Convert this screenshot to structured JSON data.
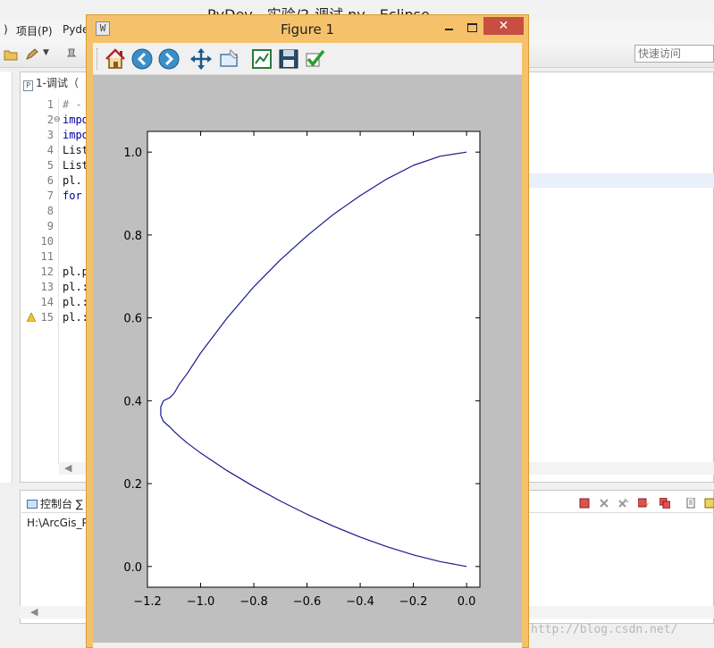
{
  "eclipse": {
    "title": "PyDev - 实验/2-调试.py - Eclipse",
    "menu": {
      "project": "项目(P)",
      "pydev": "Pyde"
    },
    "quick_access_placeholder": "快速访问",
    "editor_tab": "1-调试（",
    "line_numbers": [
      "1",
      "2",
      "3",
      "4",
      "5",
      "6",
      "7",
      "8",
      "9",
      "10",
      "11",
      "12",
      "13",
      "14",
      "15"
    ],
    "code_lines": [
      "# -",
      "impo",
      "impo",
      "List",
      "List",
      "pl.",
      "for",
      "",
      "",
      "",
      "",
      "pl.p",
      "pl.:",
      "pl.:",
      "pl.:"
    ],
    "console_tab": "控制台 ∑",
    "console_path": "H:\\ArcGis_P",
    "watermark": "http://blog.csdn.net/"
  },
  "figure": {
    "title": "Figure 1",
    "close_glyph": "✕",
    "app_icon_glyph": "W",
    "toolbar": [
      "home-icon",
      "back-arrow-icon",
      "forward-arrow-icon",
      "pan-move-icon",
      "zoom-rect-icon",
      "subplots-config-icon",
      "save-floppy-icon",
      "check-icon"
    ]
  },
  "chart_data": {
    "type": "line",
    "title": "",
    "xlabel": "",
    "ylabel": "",
    "xlim": [
      -1.2,
      0.05
    ],
    "ylim": [
      -0.05,
      1.05
    ],
    "xticks": [
      -1.2,
      -1.0,
      -0.8,
      -0.6,
      -0.4,
      -0.2,
      0.0
    ],
    "xtick_labels": [
      "−1.2",
      "−1.0",
      "−0.8",
      "−0.6",
      "−0.4",
      "−0.2",
      "0.0"
    ],
    "yticks": [
      0.0,
      0.2,
      0.4,
      0.6,
      0.8,
      1.0
    ],
    "ytick_labels": [
      "0.0",
      "0.2",
      "0.4",
      "0.6",
      "0.8",
      "1.0"
    ],
    "grid": false,
    "line_color": "#1a1a8c",
    "series": [
      {
        "x": [
          0.0,
          -0.1,
          -0.2,
          -0.3,
          -0.4,
          -0.5,
          -0.6,
          -0.7,
          -0.8,
          -0.9,
          -1.0,
          -1.05,
          -1.08,
          -1.1,
          -1.115,
          -1.14,
          -1.15,
          -1.15,
          -1.14,
          -1.115,
          -1.1,
          -1.08,
          -1.05,
          -1.0,
          -0.9,
          -0.8,
          -0.7,
          -0.6,
          -0.5,
          -0.4,
          -0.3,
          -0.2,
          -0.1,
          0.0
        ],
        "y": [
          0.0,
          0.012,
          0.028,
          0.048,
          0.071,
          0.097,
          0.126,
          0.158,
          0.193,
          0.231,
          0.274,
          0.298,
          0.314,
          0.326,
          0.336,
          0.35,
          0.365,
          0.385,
          0.4,
          0.408,
          0.418,
          0.44,
          0.466,
          0.515,
          0.6,
          0.675,
          0.74,
          0.798,
          0.85,
          0.895,
          0.935,
          0.968,
          0.99,
          1.0
        ]
      }
    ]
  }
}
